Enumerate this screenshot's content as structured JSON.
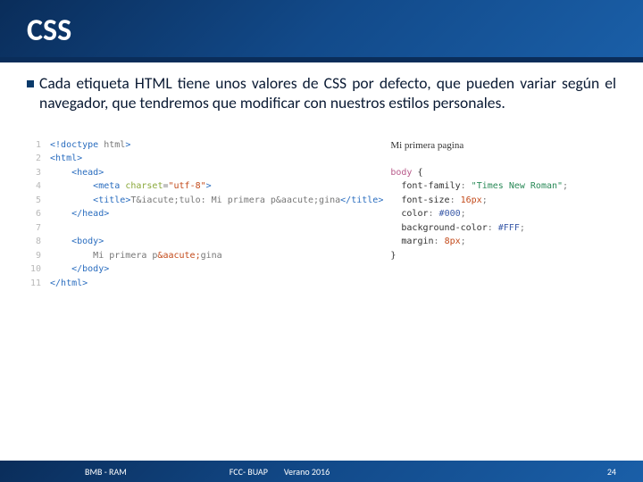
{
  "header": {
    "title": "CSS"
  },
  "body": {
    "paragraph": "Cada etiqueta HTML tiene unos valores de CSS por defecto, que pueden variar según el navegador, que tendremos que modificar con nuestros estilos personales."
  },
  "code_left": {
    "line_numbers": [
      "1",
      "2",
      "3",
      "4",
      "5",
      "6",
      "7",
      "8",
      "9",
      "10",
      "11"
    ],
    "l1_a": "<!",
    "l1_b": "doctype",
    "l1_c": " html",
    "l1_d": ">",
    "l2_a": "<",
    "l2_b": "html",
    "l2_c": ">",
    "l3_a": "<",
    "l3_b": "head",
    "l3_c": ">",
    "l4_a": "<",
    "l4_b": "meta",
    "l4_c": " charset",
    "l4_d": "=",
    "l4_e": "\"utf-8\"",
    "l4_f": ">",
    "l5_a": "<",
    "l5_b": "title",
    "l5_c": ">",
    "l5_d": "T&iacute;tulo: Mi primera p&aacute;gina",
    "l5_e": "</",
    "l5_f": "title",
    "l5_g": ">",
    "l6_a": "</",
    "l6_b": "head",
    "l6_c": ">",
    "l8_a": "<",
    "l8_b": "body",
    "l8_c": ">",
    "l9_a": "Mi primera p",
    "l9_b": "&aacute;",
    "l9_c": "gina",
    "l10_a": "</",
    "l10_b": "body",
    "l10_c": ">",
    "l11_a": "</",
    "l11_b": "html",
    "l11_c": ">"
  },
  "code_right": {
    "preview_title": "Mi primera pagina",
    "sel": "body",
    "brace_o": " {",
    "brace_c": "}",
    "p1": "font-family",
    "v1": "\"Times New Roman\"",
    "p2": "font-size",
    "v2": "16px",
    "p3": "color",
    "v3": "#000",
    "p4": "background-color",
    "v4": "#FFF",
    "p5": "margin",
    "v5": "8px",
    "colon": ": ",
    "semi": ";"
  },
  "footer": {
    "left1": "BMB - RAM",
    "left2": "FCC- BUAP",
    "left3": "Verano 2016",
    "right": "24"
  }
}
